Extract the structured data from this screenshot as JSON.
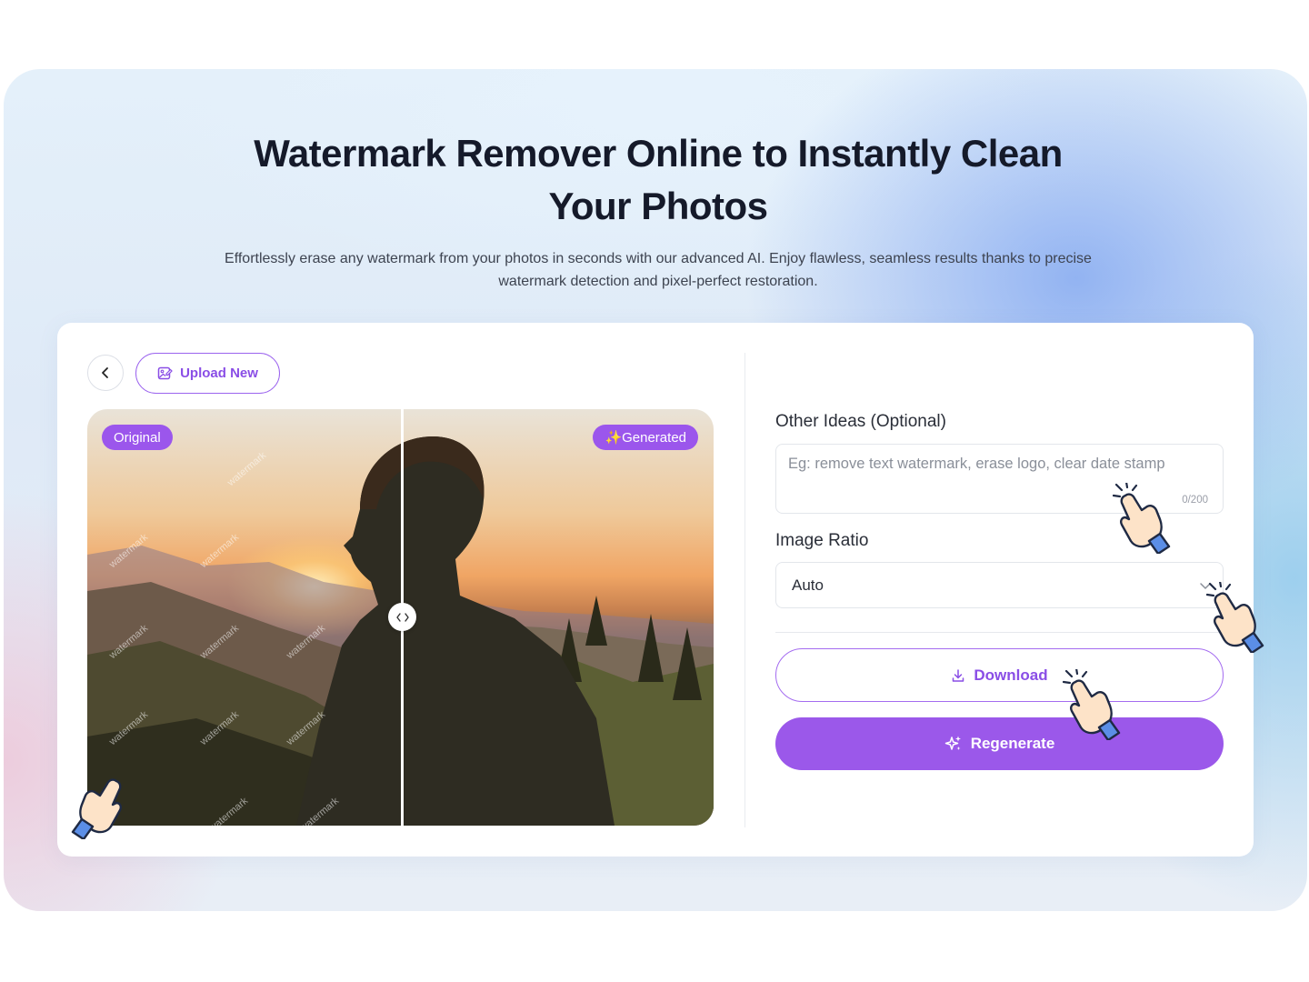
{
  "hero": {
    "title": "Watermark Remover Online to Instantly Clean Your Photos",
    "subtitle": "Effortlessly erase any watermark from your photos in seconds with our advanced AI. Enjoy flawless, seamless results thanks to precise watermark detection and pixel-perfect restoration."
  },
  "toolbar": {
    "back_icon": "chevron-left-icon",
    "upload_label": "Upload New",
    "upload_icon": "image-edit-icon"
  },
  "preview": {
    "original_label": "Original",
    "generated_label": "✨Generated",
    "watermark_text": "watermark",
    "compare_handle_icon": "compare-arrows-icon"
  },
  "form": {
    "ideas_label": "Other Ideas (Optional)",
    "ideas_placeholder": "Eg: remove text watermark, erase logo, clear date stamp",
    "ideas_count": "0/200",
    "ratio_label": "Image Ratio",
    "ratio_value": "Auto",
    "ratio_icon": "chevron-down-icon",
    "download_label": "Download",
    "download_icon": "download-icon",
    "regenerate_label": "Regenerate",
    "regenerate_icon": "sparkles-icon"
  },
  "colors": {
    "accent": "#9b58ea",
    "accent_text": "#8a4ee6",
    "title": "#151a2a"
  }
}
